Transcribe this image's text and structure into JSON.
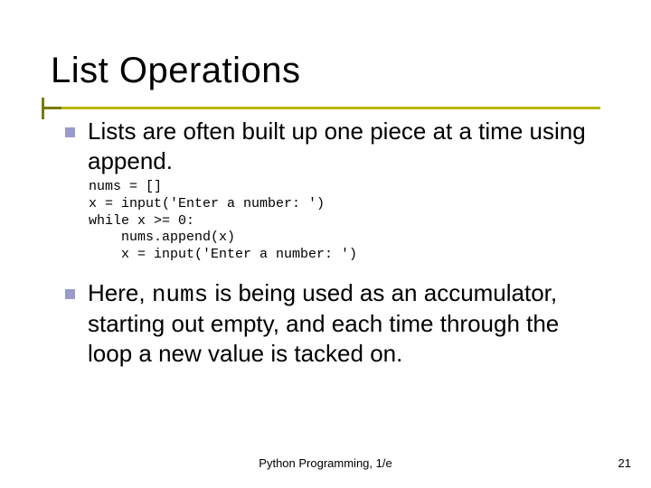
{
  "title": "List Operations",
  "bullets": [
    {
      "text": "Lists are often built up one piece at a time using append."
    },
    {
      "prefix": "Here, ",
      "mono": "nums",
      "suffix": " is being used as an accumulator, starting out empty, and each time through the loop a new value is tacked on."
    }
  ],
  "code": "nums = []\nx = input('Enter a number: ')\nwhile x >= 0:\n    nums.append(x)\n    x = input('Enter a number: ')",
  "footer": {
    "center": "Python Programming, 1/e",
    "page": "21"
  }
}
